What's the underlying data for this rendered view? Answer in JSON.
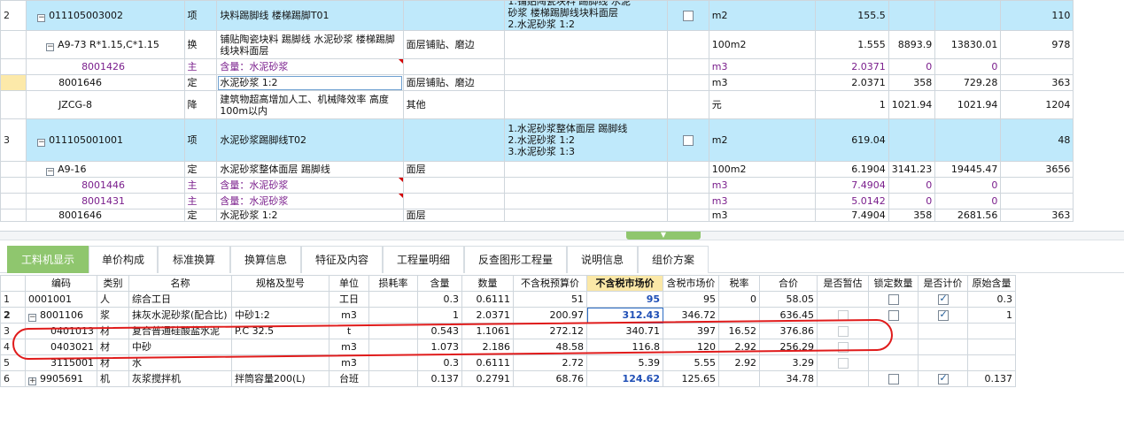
{
  "top_rows": [
    {
      "kind": "qd",
      "rownum": "2",
      "expander": "−",
      "code": "011105003002",
      "type": "项",
      "name": "块料踢脚线 楼梯踢脚T01",
      "feature": "",
      "desc": "砂浆  楼梯踢脚线块料面层\n2.水泥砂浆 1:2",
      "desc_partial_top": "1.铺贴陶瓷块料 踢脚线 水泥",
      "checkbox": false,
      "unit": "m2",
      "qty": "155.5",
      "price": "",
      "total": "",
      "last": "110"
    },
    {
      "kind": "de",
      "rownum": "",
      "expander": "−",
      "code": "A9-73 R*1.15,C*1.15",
      "type": "换",
      "name": "铺贴陶瓷块料 踢脚线 水泥砂浆  楼梯踢脚线块料面层",
      "feature": "面层铺贴、磨边",
      "unit": "100m2",
      "qty": "1.555",
      "price": "8893.9",
      "total": "13830.01",
      "last": "978"
    },
    {
      "kind": "zc",
      "rownum": "",
      "code": "8001426",
      "type": "主",
      "name": "含量：水泥砂浆",
      "feature": "",
      "unit": "m3",
      "qty": "2.0371",
      "price": "0",
      "total": "0",
      "last": ""
    },
    {
      "kind": "de",
      "rownum": "",
      "code": "8001646",
      "type": "定",
      "name": "水泥砂浆 1:2",
      "feature": "面层铺贴、磨边",
      "unit": "m3",
      "qty": "2.0371",
      "price": "358",
      "total": "729.28",
      "last": "363"
    },
    {
      "kind": "de",
      "rownum": "",
      "code": "JZCG-8",
      "type": "降",
      "name": "建筑物超高增加人工、机械降效率 高度100m以内",
      "feature": "其他",
      "unit": "元",
      "qty": "1",
      "price": "1021.94",
      "total": "1021.94",
      "last": "1204"
    },
    {
      "kind": "qd",
      "rownum": "3",
      "expander": "−",
      "code": "011105001001",
      "type": "项",
      "name": "水泥砂浆踢脚线T02",
      "feature": "",
      "desc": "1.水泥砂浆整体面层 踢脚线\n2.水泥砂浆 1:2\n3.水泥砂浆 1:3",
      "checkbox": false,
      "unit": "m2",
      "qty": "619.04",
      "price": "",
      "total": "",
      "last": "48"
    },
    {
      "kind": "de",
      "rownum": "",
      "expander": "−",
      "code": "A9-16",
      "type": "定",
      "name": "水泥砂浆整体面层 踢脚线",
      "feature": "面层",
      "unit": "100m2",
      "qty": "6.1904",
      "price": "3141.23",
      "total": "19445.47",
      "last": "3656"
    },
    {
      "kind": "zc",
      "rownum": "",
      "code": "8001446",
      "type": "主",
      "name": "含量：水泥砂浆",
      "feature": "",
      "unit": "m3",
      "qty": "7.4904",
      "price": "0",
      "total": "0",
      "last": ""
    },
    {
      "kind": "zc",
      "rownum": "",
      "code": "8001431",
      "type": "主",
      "name": "含量：水泥砂浆",
      "feature": "",
      "unit": "m3",
      "qty": "5.0142",
      "price": "0",
      "total": "0",
      "last": ""
    },
    {
      "kind": "de",
      "rownum": "",
      "code": "8001646",
      "type": "定",
      "name": "水泥砂浆 1:2",
      "feature": "面层",
      "unit": "m3",
      "qty": "7.4904",
      "price": "358",
      "total": "2681.56",
      "last": "363"
    }
  ],
  "tabs": [
    "工料机显示",
    "单价构成",
    "标准换算",
    "换算信息",
    "特征及内容",
    "工程量明细",
    "反查图形工程量",
    "说明信息",
    "组价方案"
  ],
  "headers": [
    "",
    "编码",
    "类别",
    "名称",
    "规格及型号",
    "单位",
    "损耗率",
    "含量",
    "数量",
    "不含税预算价",
    "不含税市场价",
    "含税市场价",
    "税率",
    "合价",
    "是否暂估",
    "锁定数量",
    "是否计价",
    "原始含量"
  ],
  "rows": [
    {
      "rn": "1",
      "code": "0001001",
      "cat": "人",
      "name": "综合工日",
      "spec": "",
      "unit": "工日",
      "loss": "",
      "content": "0.3",
      "qty": "0.6111",
      "budget": "51",
      "market": "95",
      "market_style": "blue",
      "tax_market": "95",
      "tax": "0",
      "total": "58.05",
      "est": false,
      "lock": false,
      "lock_box": true,
      "price": true,
      "price_box": true,
      "orig": "0.3"
    },
    {
      "rn": "2",
      "expander": "−",
      "code": "8001106",
      "cat": "浆",
      "name": "抹灰水泥砂浆(配合比)",
      "spec": "中砂1:2",
      "unit": "m3",
      "loss": "",
      "content": "1",
      "qty": "2.0371",
      "budget": "200.97",
      "market": "312.43",
      "market_style": "blue",
      "tax_market": "346.72",
      "tax": "",
      "total": "636.45",
      "est": false,
      "est_dis": true,
      "lock": false,
      "lock_box": true,
      "price": true,
      "price_box": true,
      "orig": "1"
    },
    {
      "rn": "3",
      "code": "0401013",
      "cat": "材",
      "name": "复合普通硅酸盐水泥",
      "spec": "P.C 32.5",
      "unit": "t",
      "loss": "",
      "content": "0.543",
      "qty": "1.1061",
      "budget": "272.12",
      "market": "340.71",
      "market_style": "plain",
      "tax_market": "397",
      "tax": "16.52",
      "total": "376.86",
      "est": false,
      "lock_box": false,
      "price_box": false,
      "orig": ""
    },
    {
      "rn": "4",
      "code": "0403021",
      "cat": "材",
      "name": "中砂",
      "spec": "",
      "unit": "m3",
      "loss": "",
      "content": "1.073",
      "qty": "2.186",
      "budget": "48.58",
      "market": "116.8",
      "market_style": "plain",
      "tax_market": "120",
      "tax": "2.92",
      "total": "256.29",
      "est": false,
      "lock_box": false,
      "price_box": false,
      "orig": ""
    },
    {
      "rn": "5",
      "code": "3115001",
      "cat": "材",
      "name": "水",
      "spec": "",
      "unit": "m3",
      "loss": "",
      "content": "0.3",
      "qty": "0.6111",
      "budget": "2.72",
      "market": "5.39",
      "market_style": "plain",
      "tax_market": "5.55",
      "tax": "2.92",
      "total": "3.29",
      "est": false,
      "lock_box": false,
      "price_box": false,
      "orig": ""
    },
    {
      "rn": "6",
      "expander": "+",
      "code": "9905691",
      "cat": "机",
      "name": "灰浆搅拌机",
      "spec": "拌筒容量200(L)",
      "unit": "台班",
      "loss": "",
      "content": "0.137",
      "qty": "0.2791",
      "budget": "68.76",
      "market": "124.62",
      "market_style": "blue",
      "tax_market": "125.65",
      "tax": "",
      "total": "34.78",
      "est": false,
      "lock": false,
      "lock_box": true,
      "price": true,
      "price_box": true,
      "orig": "0.137"
    }
  ],
  "colors": {
    "accent": "#8fc66e",
    "qd_row": "#bfe9fb",
    "annotation": "#e01b1b",
    "blue_value": "#1f4fb6",
    "highlight_header": "#fbe8a7"
  }
}
